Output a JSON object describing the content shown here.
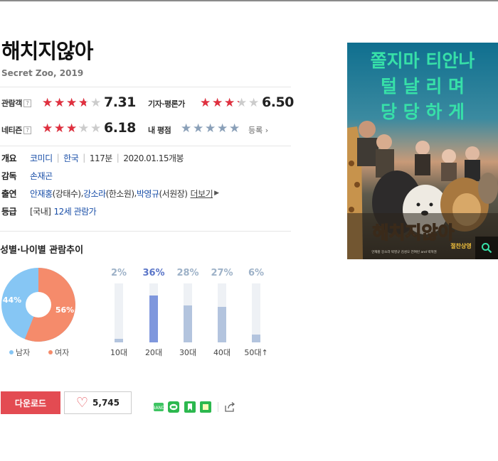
{
  "movie": {
    "title": "해치지않아",
    "subtitle": "Secret Zoo, 2019"
  },
  "ratings": {
    "audience": {
      "label": "관람객",
      "help": "?",
      "score": "7.31",
      "stars": 3.655
    },
    "critic": {
      "label": "기자·평론가",
      "score": "6.50",
      "stars": 3.25
    },
    "netizen": {
      "label": "네티즌",
      "help": "?",
      "score": "6.18",
      "stars": 3.09
    },
    "my": {
      "label": "내 평점",
      "register": "등록 ›",
      "stars": 0
    }
  },
  "info": {
    "overview": {
      "key": "개요",
      "genre": "코미디",
      "country": "한국",
      "runtime": "117분",
      "release": "2020.01.15개봉"
    },
    "director": {
      "key": "감독",
      "name": "손재곤"
    },
    "cast": {
      "key": "출연",
      "actors": [
        {
          "name": "안재홍",
          "role": "(강태수)"
        },
        {
          "name": "강소라",
          "role": "(한소원)"
        },
        {
          "name": "박영규",
          "role": "(서원장)"
        }
      ],
      "separator": ", ",
      "more": "더보기"
    },
    "grade": {
      "key": "등급",
      "prefix": "[국내]",
      "value": "12세 관람가"
    }
  },
  "trend": {
    "title": "성별·나이별 관람추이",
    "gender": {
      "male": {
        "label": "남자",
        "pct": 44,
        "text": "44%",
        "color": "#86c6f4"
      },
      "female": {
        "label": "여자",
        "pct": 56,
        "text": "56%",
        "color": "#f58b6b"
      }
    },
    "ages": [
      {
        "label": "10대",
        "pct": 2,
        "text": "2%",
        "highlight": false
      },
      {
        "label": "20대",
        "pct": 36,
        "text": "36%",
        "highlight": true
      },
      {
        "label": "30대",
        "pct": 28,
        "text": "28%",
        "highlight": false
      },
      {
        "label": "40대",
        "pct": 27,
        "text": "27%",
        "highlight": false
      },
      {
        "label": "50대",
        "pct": 6,
        "text": "6%",
        "highlight": false,
        "arrow": "↑"
      }
    ]
  },
  "actions": {
    "download": "다운로드",
    "likes": "5,745"
  },
  "poster": {
    "lines": [
      "쫄지마 티안나",
      "털 날 리 며",
      "당 당 하 게"
    ],
    "logo": "해치지않아",
    "date": "절찬상영",
    "credits": "안재홍 강소라 박영규 김성오 전여빈 and 박혁권"
  },
  "colors": {
    "accent": "#e34b52",
    "star": "#e0303f",
    "link": "#1a4fa8",
    "poster_text": "#37e0a8"
  }
}
